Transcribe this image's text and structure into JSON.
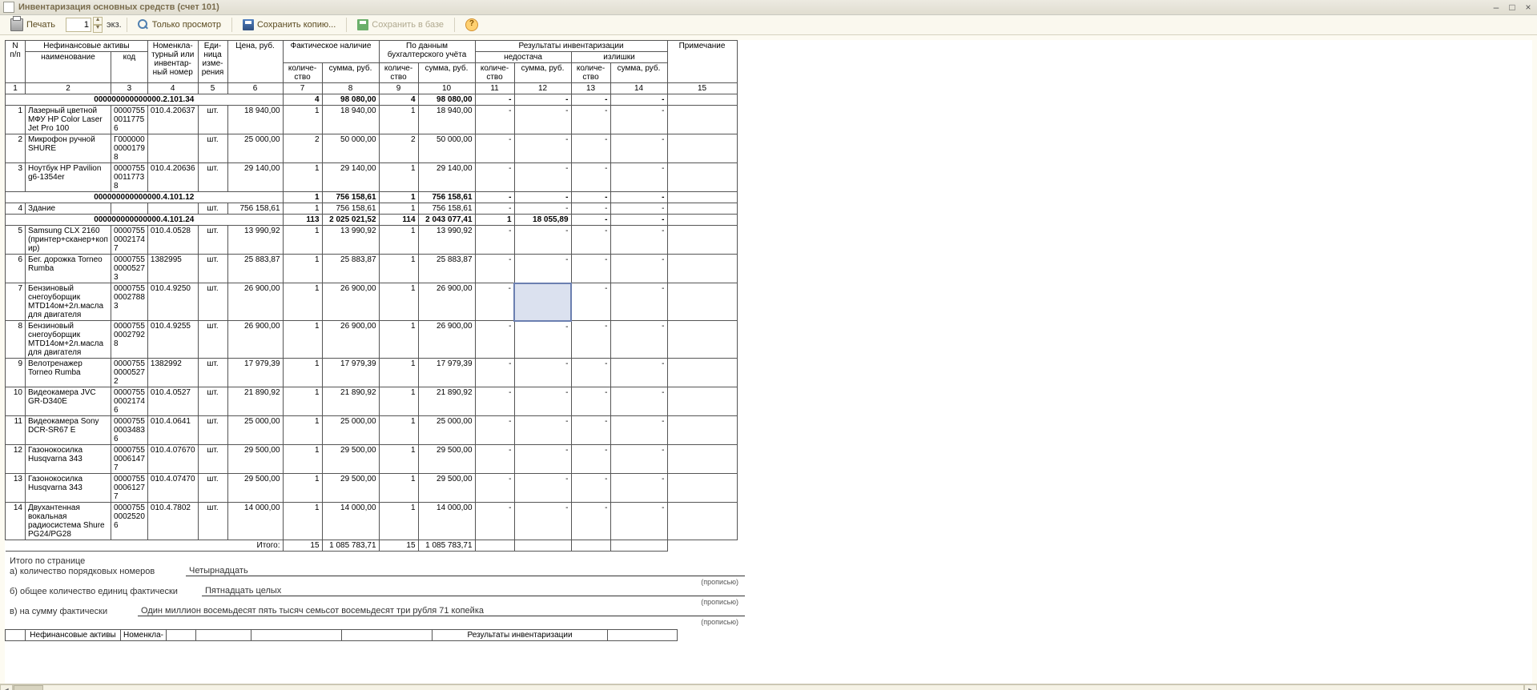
{
  "window": {
    "title": "Инвентаризация основных средств (счет 101)",
    "minimize": "–",
    "maximize": "□",
    "close": "×"
  },
  "toolbar": {
    "print": "Печать",
    "copies": "1",
    "copies_suffix": "экз.",
    "view_only": "Только просмотр",
    "save_copy": "Сохранить копию...",
    "save_db": "Сохранить в базе",
    "help": "?"
  },
  "headers": {
    "col_n": "N п/п",
    "assets": "Нефинансовые активы",
    "name": "наименование",
    "code": "код",
    "inv_num": "Номенкла-турный или инвентар-ный номер",
    "unit": "Еди-ница изме-рения",
    "price": "Цена, руб.",
    "actual": "Фактическое наличие",
    "by_accounting": "По данным бухгалтерского учёта",
    "results": "Результаты инвентаризации",
    "shortage": "недостача",
    "surplus": "излишки",
    "note": "Примечание",
    "qty": "количе-ство",
    "sum": "сумма, руб.",
    "nums": [
      "1",
      "2",
      "3",
      "4",
      "5",
      "6",
      "7",
      "8",
      "9",
      "10",
      "11",
      "12",
      "13",
      "14",
      "15"
    ]
  },
  "groups": [
    {
      "label": "000000000000000.2.101.34",
      "totals": {
        "aq": "4",
        "as": "98 080,00",
        "bq": "4",
        "bs": "98 080,00"
      },
      "rows": [
        {
          "n": "1",
          "name": "Лазерный цветной МФУ HP Color Laser Jet Pro 100",
          "code": "0000755 0011775 6",
          "inv": "010.4.20637",
          "unit": "шт.",
          "price": "18 940,00",
          "aq": "1",
          "as": "18 940,00",
          "bq": "1",
          "bs": "18 940,00"
        },
        {
          "n": "2",
          "name": "Микрофон ручной SHURE",
          "code": "Г000000 0000179 8",
          "inv": "",
          "unit": "шт.",
          "price": "25 000,00",
          "aq": "2",
          "as": "50 000,00",
          "bq": "2",
          "bs": "50 000,00"
        },
        {
          "n": "3",
          "name": "Ноутбук HP Pavilion g6-1354er",
          "code": "0000755 0011773 8",
          "inv": "010.4.20636",
          "unit": "шт.",
          "price": "29 140,00",
          "aq": "1",
          "as": "29 140,00",
          "bq": "1",
          "bs": "29 140,00"
        }
      ]
    },
    {
      "label": "000000000000000.4.101.12",
      "totals": {
        "aq": "1",
        "as": "756 158,61",
        "bq": "1",
        "bs": "756 158,61"
      },
      "rows": [
        {
          "n": "4",
          "name": "Здание",
          "code": "",
          "inv": "",
          "unit": "шт.",
          "price": "756 158,61",
          "aq": "1",
          "as": "756 158,61",
          "bq": "1",
          "bs": "756 158,61"
        }
      ]
    },
    {
      "label": "000000000000000.4.101.24",
      "totals": {
        "aq": "113",
        "as": "2 025 021,52",
        "bq": "114",
        "bs": "2 043 077,41",
        "sq": "1",
        "ss": "18 055,89"
      },
      "rows": [
        {
          "n": "5",
          "name": "Samsung  CLX 2160 (принтер+сканер+коп ир)",
          "code": "0000755 0002174 7",
          "inv": "010.4.0528",
          "unit": "шт.",
          "price": "13 990,92",
          "aq": "1",
          "as": "13 990,92",
          "bq": "1",
          "bs": "13 990,92"
        },
        {
          "n": "6",
          "name": "Бег. дорожка Torneo Rumba",
          "code": "0000755 0000527 3",
          "inv": "1382995",
          "unit": "шт.",
          "price": "25 883,87",
          "aq": "1",
          "as": "25 883,87",
          "bq": "1",
          "bs": "25 883,87"
        },
        {
          "n": "7",
          "name": "Бензиновый снегоуборщик МТD14ом+2л.масла для двигателя",
          "code": "0000755 0002788 3",
          "inv": "010.4.9250",
          "unit": "шт.",
          "price": "26 900,00",
          "aq": "1",
          "as": "26 900,00",
          "bq": "1",
          "bs": "26 900,00",
          "selected": true
        },
        {
          "n": "8",
          "name": "Бензиновый снегоуборщик МТD14ом+2л.масла для двигателя",
          "code": "0000755 0002792 8",
          "inv": "010.4.9255",
          "unit": "шт.",
          "price": "26 900,00",
          "aq": "1",
          "as": "26 900,00",
          "bq": "1",
          "bs": "26 900,00"
        },
        {
          "n": "9",
          "name": "Велотренажер Torneo Rumba",
          "code": "0000755 0000527 2",
          "inv": "1382992",
          "unit": "шт.",
          "price": "17 979,39",
          "aq": "1",
          "as": "17 979,39",
          "bq": "1",
          "bs": "17 979,39"
        },
        {
          "n": "10",
          "name": "Видеокамера JVC GR-D340E",
          "code": "0000755 0002174 6",
          "inv": "010.4.0527",
          "unit": "шт.",
          "price": "21 890,92",
          "aq": "1",
          "as": "21 890,92",
          "bq": "1",
          "bs": "21 890,92"
        },
        {
          "n": "11",
          "name": "Видеокамера Sony DCR-SR67 E",
          "code": "0000755 0003483 6",
          "inv": "010.4.0641",
          "unit": "шт.",
          "price": "25 000,00",
          "aq": "1",
          "as": "25 000,00",
          "bq": "1",
          "bs": "25 000,00"
        },
        {
          "n": "12",
          "name": "Газонокосилка Husqvarna 343",
          "code": "0000755 0006147 7",
          "inv": "010.4.07670",
          "unit": "шт.",
          "price": "29 500,00",
          "aq": "1",
          "as": "29 500,00",
          "bq": "1",
          "bs": "29 500,00"
        },
        {
          "n": "13",
          "name": "Газонокосилка Husqvarna 343",
          "code": "0000755 0006127 7",
          "inv": "010.4.07470",
          "unit": "шт.",
          "price": "29 500,00",
          "aq": "1",
          "as": "29 500,00",
          "bq": "1",
          "bs": "29 500,00"
        },
        {
          "n": "14",
          "name": "Двухантенная вокальная радиосистема Shure PG24/PG28",
          "code": "0000755 0002520 6",
          "inv": "010.4.7802",
          "unit": "шт.",
          "price": "14 000,00",
          "aq": "1",
          "as": "14 000,00",
          "bq": "1",
          "bs": "14 000,00"
        }
      ]
    }
  ],
  "page_total": {
    "label": "Итого:",
    "aq": "15",
    "as": "1 085 783,71",
    "bq": "15",
    "bs": "1 085 783,71"
  },
  "summary": {
    "header": "Итого по странице",
    "a_lbl": "а) количество порядковых номеров",
    "a_val": "Четырнадцать",
    "b_lbl": "б) общее  количество единиц фактически",
    "b_val": "Пятнадцать целых",
    "c_lbl": "в) на сумму фактически",
    "c_val": "Один миллион восемьдесят пять тысяч семьсот восемьдесят три рубля 71 копейка",
    "note": "(прописью)"
  },
  "footer_headers": {
    "assets": "Нефинансовые активы",
    "invnum": "Номенкла-",
    "results": "Результаты инвентаризации"
  }
}
